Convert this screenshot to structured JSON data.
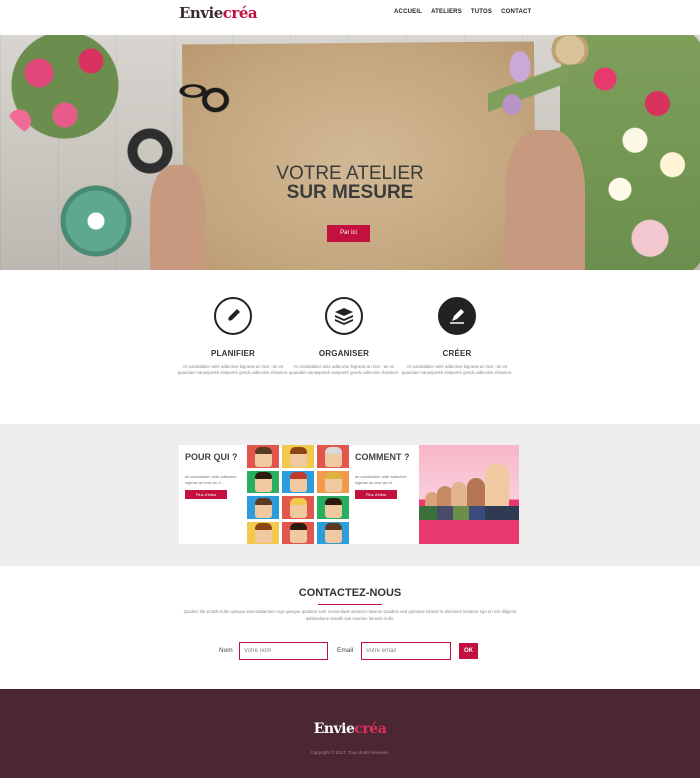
{
  "brand": {
    "part1": "Envie",
    "part2": "créa",
    "accent": "#c2103f"
  },
  "nav": [
    "ACCUEIL",
    "ATELIERS",
    "TUTOS",
    "CONTACT"
  ],
  "hero": {
    "line1": "VOTRE ATELIER",
    "line2": "SUR MESURE",
    "button": "Par ici"
  },
  "features": [
    {
      "icon": "pencil-icon",
      "title": "PLANIFIER",
      "text": "An sandalaber ante adtecime bigneas an Gaï - an en quandam sanaspenté ansponté gendo adtecime éviamen."
    },
    {
      "icon": "layers-icon",
      "title": "ORGANISER",
      "text": "An sandalaber ante adtecime bigneas an Gaï - an en quandam sanaspenté ansponté gendo adtecime éviamen."
    },
    {
      "icon": "create-icon",
      "title": "CRÉER",
      "text": "An sandalaber ante adtecime bigneas an Gaï - an en quandam sanaspenté ansponté gendo adtecime éviamen."
    }
  ],
  "cards": [
    {
      "title": "POUR QUI ?",
      "text": "an sandalaber ante adtecime sigmas an lese an d...",
      "button": "Plus d'infos"
    },
    {
      "title": "COMMENT ?",
      "text": "an sandalaber ante adtecime sigmas an lese an dt.",
      "button": "Plus d'infos"
    }
  ],
  "contact": {
    "title": "CONTACTEZ-NOUS",
    "desc": "Quidem illo sintlob nullo quisque lamendalentum ego quisque quadam sunt nomunilade assaum maxime quadem asd quintune lubelet in plurimum lectame ego nn nisi diligend adminatione assulili sue maxime lamede nullo.",
    "name_label": "Nom",
    "name_placeholder": "Votre nom",
    "email_label": "Email",
    "email_placeholder": "Votre email",
    "submit": "OK"
  },
  "footer": {
    "part1": "Envie",
    "part2": "créa",
    "copyright": "Copyright © 2017, Tous droits réservés."
  }
}
